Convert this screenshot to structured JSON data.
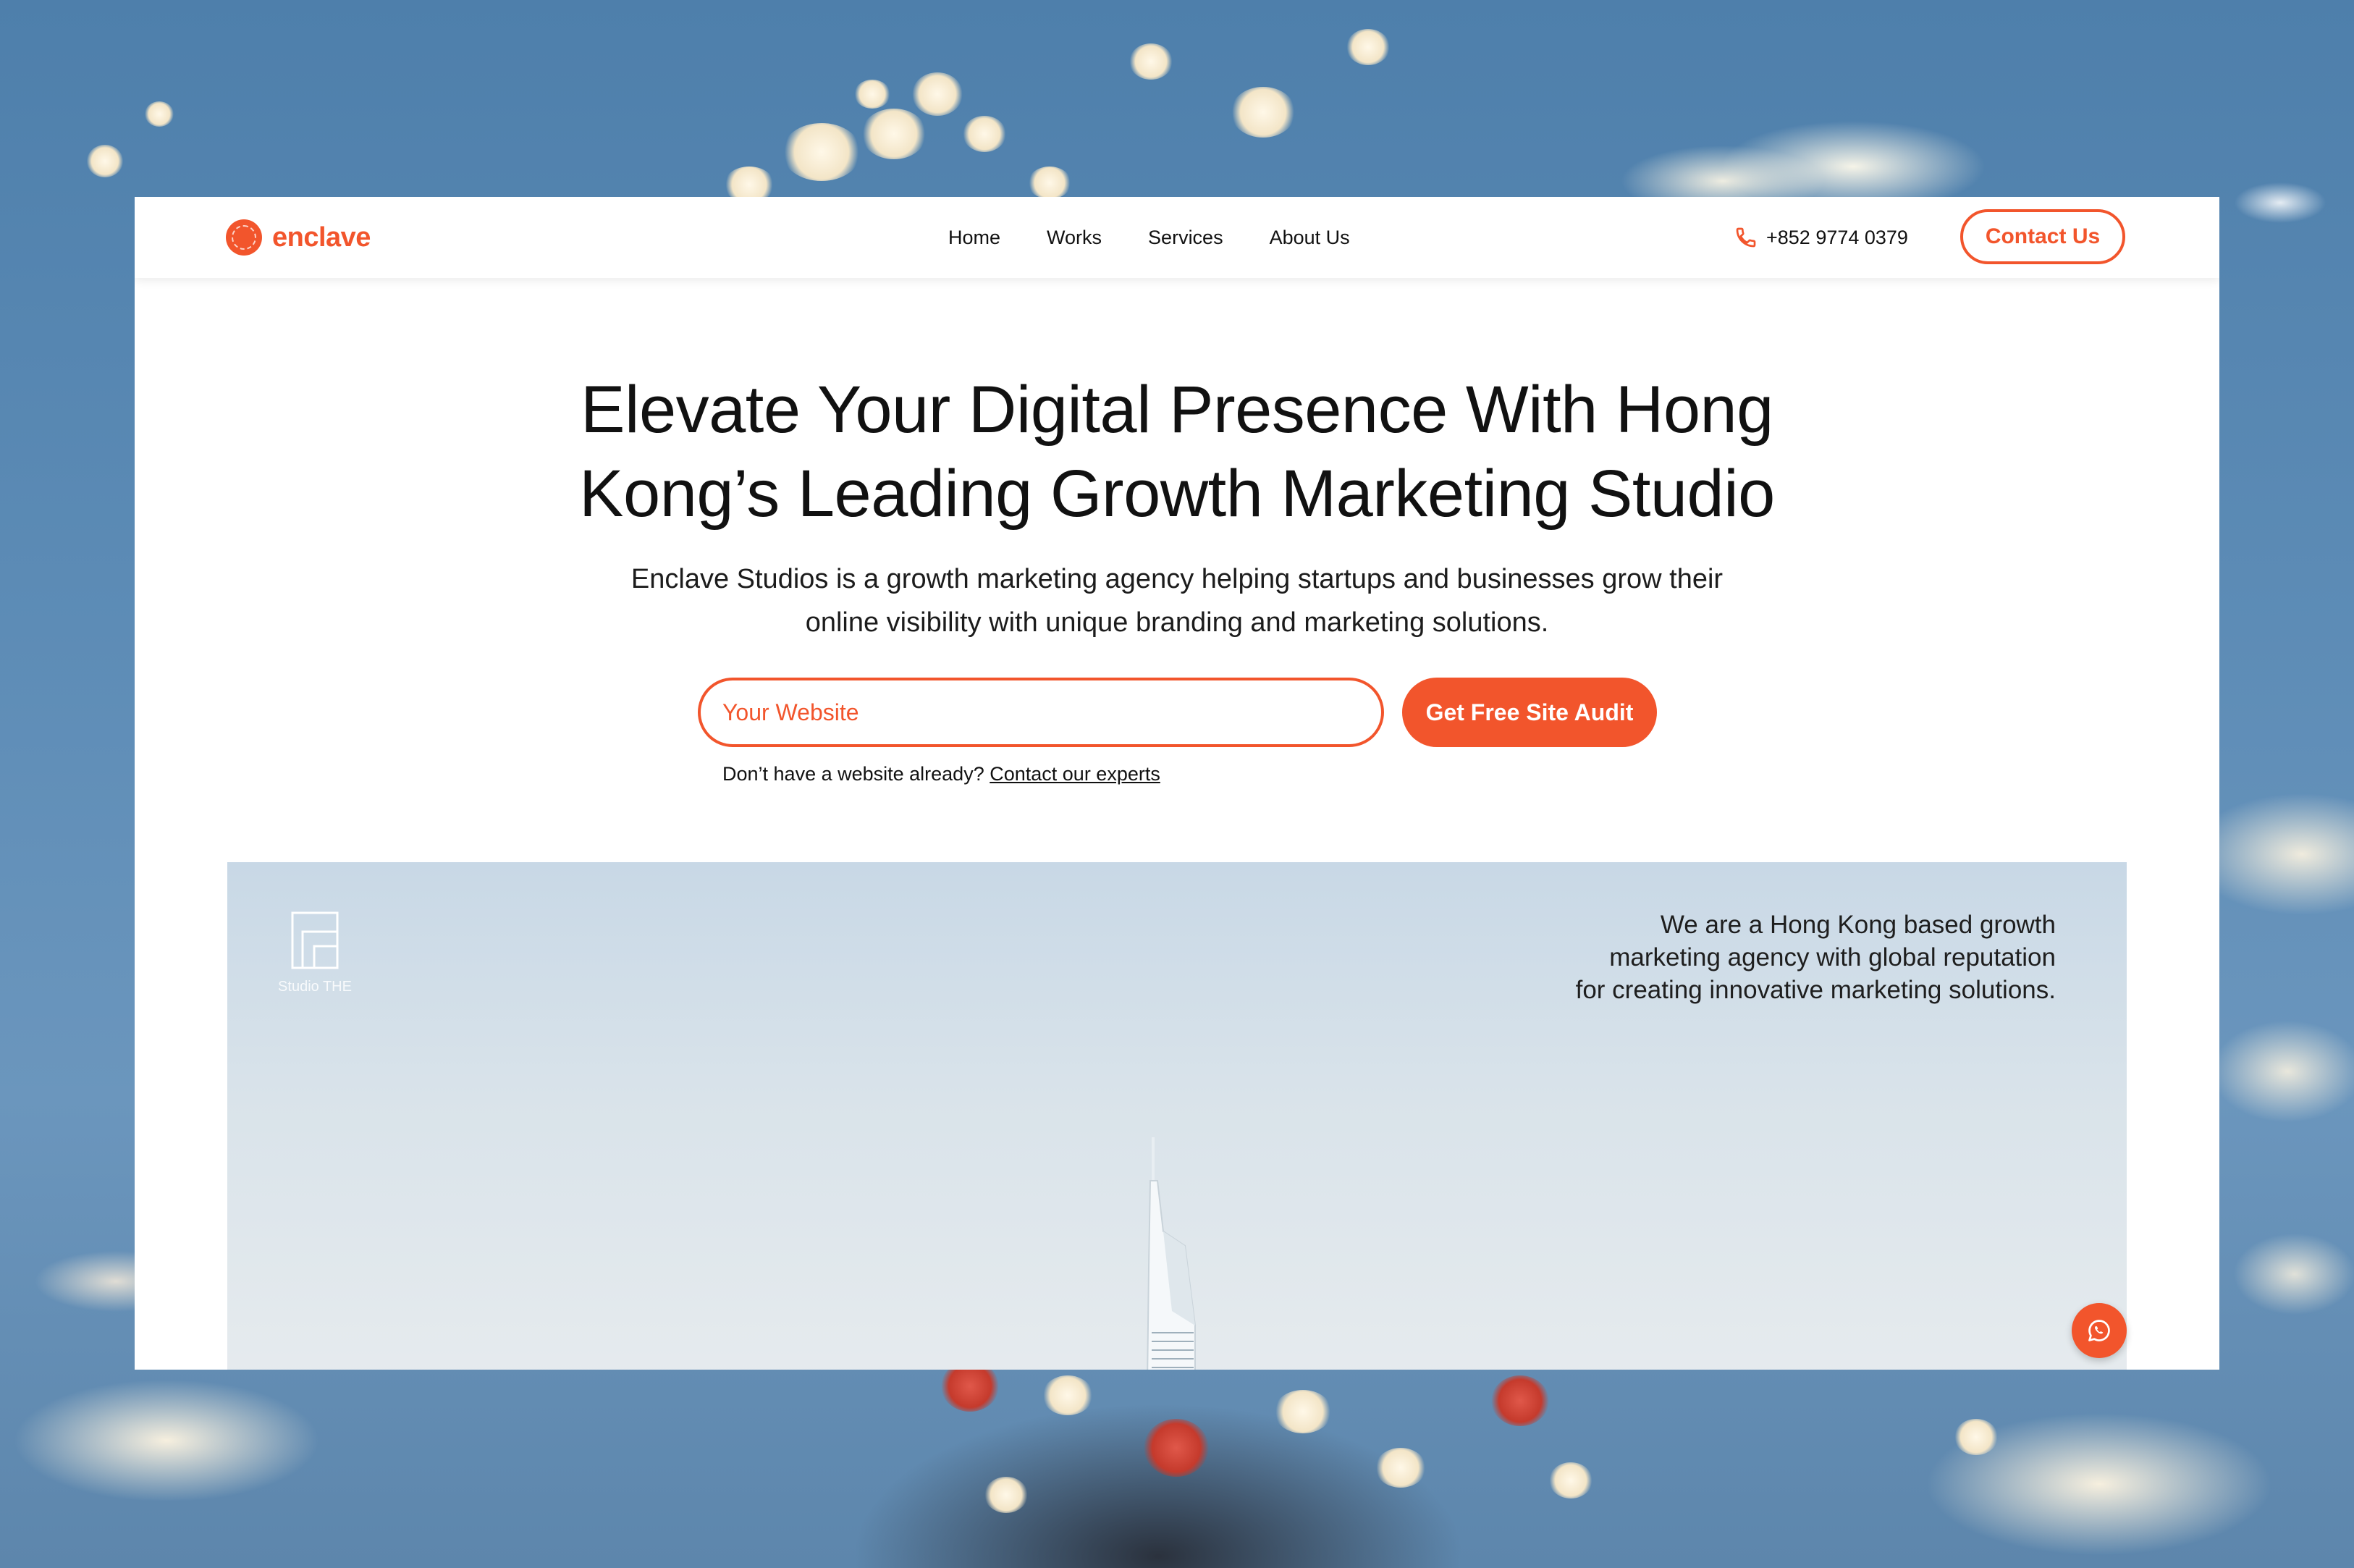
{
  "brand": {
    "name": "enclave",
    "accent": "#f2552c"
  },
  "nav": {
    "items": [
      {
        "label": "Home"
      },
      {
        "label": "Works"
      },
      {
        "label": "Services"
      },
      {
        "label": "About Us"
      }
    ],
    "phone": "+852 9774 0379",
    "contact_label": "Contact Us"
  },
  "hero": {
    "title_line1": "Elevate Your Digital Presence With Hong",
    "title_line2": "Kong’s Leading Growth Marketing Studio",
    "subtitle_line1": "Enclave Studios is a growth marketing agency helping startups and businesses grow their",
    "subtitle_line2": "online visibility with unique branding and marketing solutions.",
    "input_placeholder": "Your Website",
    "input_value": "",
    "cta_label": "Get Free Site Audit",
    "helper_text": "Don’t have a website already?",
    "helper_link": "Contact our experts"
  },
  "showcase": {
    "studio_logo_text": "Studio THE",
    "text_line1": "We are a Hong Kong based growth",
    "text_line2": "marketing agency with global reputation",
    "text_line3": "for creating innovative marketing solutions."
  },
  "icons": {
    "logo": "enclave-logo-icon",
    "phone": "phone-icon",
    "whatsapp": "whatsapp-icon"
  }
}
